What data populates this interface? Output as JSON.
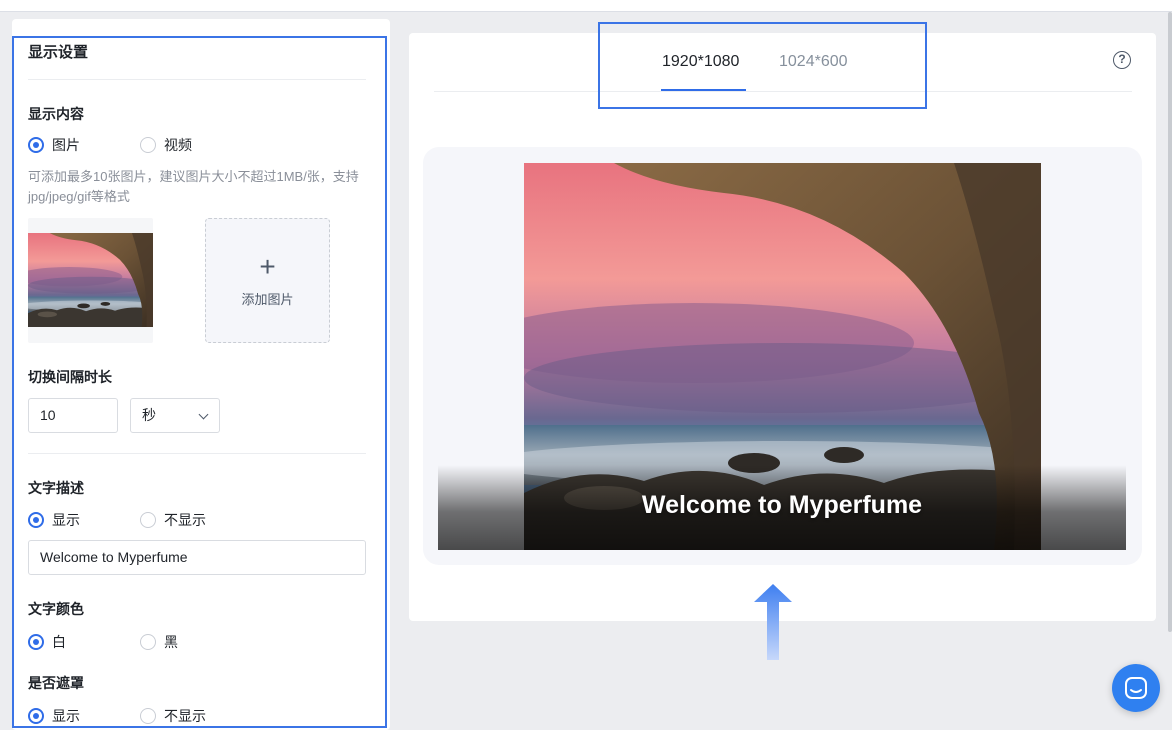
{
  "settings": {
    "title": "显示设置",
    "content_section": {
      "label": "显示内容",
      "options": [
        "图片",
        "视频"
      ],
      "selected": "图片",
      "hint": "可添加最多10张图片，建议图片大小不超过1MB/张，支持jpg/jpeg/gif等格式",
      "add_image_label": "添加图片"
    },
    "interval": {
      "label": "切换间隔时长",
      "value": "10",
      "unit": "秒"
    },
    "text_desc": {
      "label": "文字描述",
      "options": [
        "显示",
        "不显示"
      ],
      "selected": "显示",
      "value": "Welcome to Myperfume"
    },
    "text_color": {
      "label": "文字颜色",
      "options": [
        "白",
        "黑"
      ],
      "selected": "白"
    },
    "mask": {
      "label": "是否遮罩",
      "options": [
        "显示",
        "不显示"
      ],
      "selected": "显示"
    }
  },
  "preview": {
    "tabs": [
      "1920*1080",
      "1024*600"
    ],
    "active_tab": "1920*1080",
    "help_icon": "question-circle-icon",
    "overlay_text": "Welcome to Myperfume"
  },
  "colors": {
    "accent": "#2f6ce8",
    "highlight_border": "#3b74e6",
    "chat_button": "#2f80f0"
  },
  "icons": {
    "chat": "chat-bubble-icon",
    "arrow": "arrow-up-icon",
    "add": "plus-icon",
    "dropdown": "chevron-down-icon"
  }
}
